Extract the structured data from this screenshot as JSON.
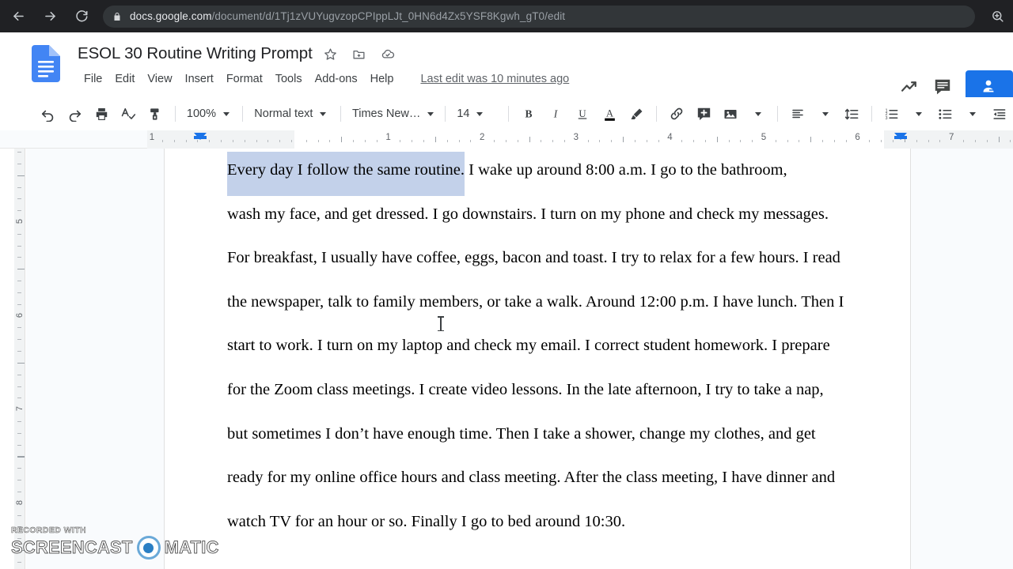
{
  "browser": {
    "back_icon": "arrow-left-icon",
    "forward_icon": "arrow-right-icon",
    "reload_icon": "reload-icon",
    "lock_icon": "lock-icon",
    "url_host": "docs.google.com",
    "url_path": "/document/d/1Tj1zVUYugvzopCPIppLJt_0HN6d4Zx5YSF8Kgwh_gT0/edit",
    "zoom_icon": "zoom-search-icon"
  },
  "docs_header": {
    "logo": "google-docs-logo",
    "title": "ESOL 30 Routine Writing Prompt",
    "title_icons": [
      "star-icon",
      "move-to-folder-icon",
      "cloud-saved-icon"
    ],
    "menus": [
      "File",
      "Edit",
      "View",
      "Insert",
      "Format",
      "Tools",
      "Add-ons",
      "Help"
    ],
    "last_edit": "Last edit was 10 minutes ago",
    "right_icons": [
      "trending-up-icon",
      "comment-icon"
    ],
    "share_button": "share-person-icon"
  },
  "toolbar": {
    "icons_left": [
      "undo-icon",
      "redo-icon",
      "print-icon",
      "spellcheck-icon",
      "paint-format-icon"
    ],
    "zoom_value": "100%",
    "style_value": "Normal text",
    "font_value": "Times New…",
    "size_value": "14",
    "format_icons": [
      "bold-icon",
      "italic-icon",
      "underline-icon",
      "text-color-icon",
      "highlight-icon"
    ],
    "insert_icons": [
      "link-icon",
      "add-comment-icon",
      "insert-image-icon"
    ],
    "paragraph_icons": [
      "align-icon",
      "line-spacing-icon",
      "numbered-list-icon",
      "bulleted-list-icon",
      "decrease-indent-icon"
    ]
  },
  "ruler": {
    "horizontal_numbers": [
      "1",
      "1",
      "2",
      "3",
      "4",
      "5",
      "6",
      "7"
    ],
    "vertical_numbers": [
      "5",
      "6",
      "7",
      "8"
    ],
    "left_indent_marker": "left-indent-marker",
    "right_indent_marker": "right-indent-marker"
  },
  "document": {
    "selected_text": "Every day I follow the same routine.",
    "lines": [
      " I wake up around 8:00 a.m.  I go to the bathroom,",
      "wash my face, and get dressed. I go downstairs. I turn on my phone and check my messages.",
      "For breakfast, I usually have coffee, eggs, bacon and toast. I try to relax for a few hours.  I read",
      "the newspaper, talk to family members, or take a walk. Around 12:00 p.m. I have lunch. Then I",
      "start to work.  I turn on my laptop and check my email.  I correct student homework.  I prepare",
      "for the Zoom class meetings.  I create video lessons. In the late afternoon, I try to take a nap,",
      "but sometimes I don’t have enough time.  Then I take a shower, change my clothes, and get",
      "ready for my online office hours and class meeting. After the class meeting, I have dinner and",
      "watch TV for an hour or so. Finally I go to bed around 10:30."
    ],
    "add_comment_fab": "add-comment-icon"
  },
  "watermark": {
    "top_line": "RECORDED WITH",
    "left_word": "SCREENCAST",
    "right_word": "MATIC"
  },
  "colors": {
    "chrome_bar": "#202124",
    "omnibox": "#323639",
    "accent_blue": "#1a73e8",
    "selection": "#c3d1ea",
    "canvas_bg": "#f9fbfd"
  }
}
